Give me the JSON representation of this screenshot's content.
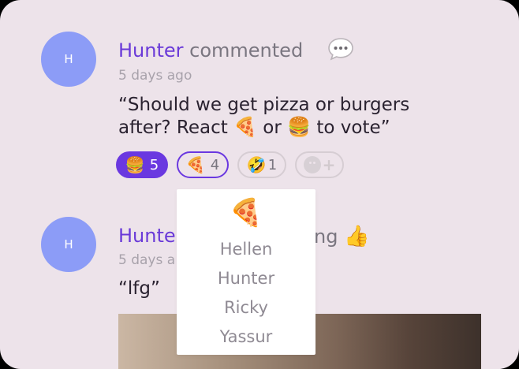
{
  "comment1": {
    "avatar_initial": "H",
    "author": "Hunter",
    "action": "commented",
    "action_icon": "speech-bubble-icon",
    "time": "5 days ago",
    "text_line1": "“Should we get pizza or burgers",
    "text_line2_a": "after? React ",
    "text_line2_b": " or ",
    "text_line2_c": " to vote”",
    "emoji_pizza": "🍕",
    "emoji_burger": "🍔"
  },
  "reactions": [
    {
      "emoji": "🍔",
      "count": "5",
      "selected": true
    },
    {
      "emoji": "🍕",
      "count": "4",
      "focused": true
    },
    {
      "emoji": "🤣",
      "count": "1"
    },
    {
      "icon": "add-reaction-icon"
    }
  ],
  "tooltip": {
    "emoji": "🍕",
    "names": [
      "Hellen",
      "Hunter",
      "Ricky",
      "Yassur"
    ]
  },
  "comment2": {
    "avatar_initial": "H",
    "author_visible": "Hunte",
    "action_visible": "ng",
    "action_icon": "👍",
    "time_visible": "5 days a",
    "text": "“lfg”"
  },
  "colors": {
    "background": "#ede3ea",
    "accent": "#6a38e0",
    "avatar": "#8c9cf7"
  }
}
